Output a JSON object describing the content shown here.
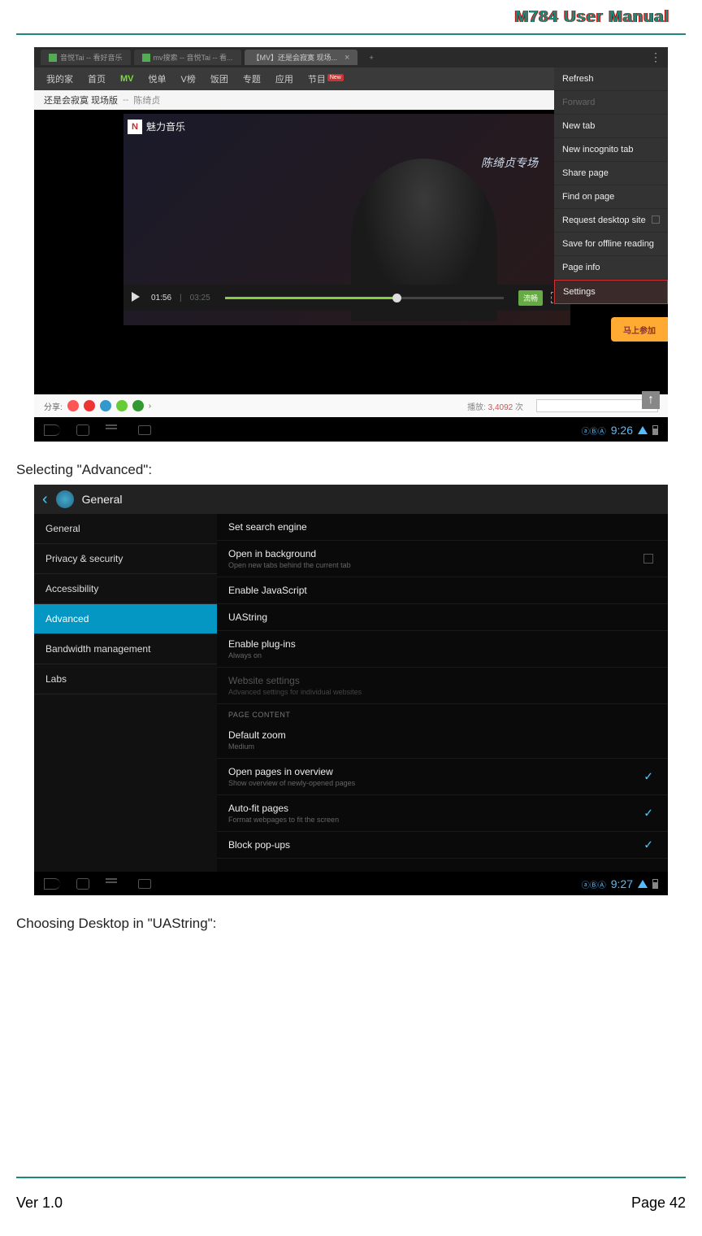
{
  "header": {
    "title": "M784  User  Manual"
  },
  "screenshot1": {
    "tabs": [
      {
        "label": "音悦Tai -- 看好音乐"
      },
      {
        "label": "mv搜索 -- 音悦Tai -- 看..."
      },
      {
        "label": "【MV】还是会寂寞 现场..."
      }
    ],
    "tab_add": "+",
    "tab_menu": "⋮",
    "nav": [
      "我的家",
      "首页",
      "MV",
      "悦单",
      "V榜",
      "饭团",
      "专题",
      "应用",
      "节目"
    ],
    "nav_new": "New",
    "song_title": "还是会寂寞 现场版",
    "song_sep": "--",
    "song_artist": "陈绮贞",
    "video_logo": "N",
    "video_logo_text": "魅力音乐",
    "video_overlay": "陈绮贞专场",
    "join_badge": "马上参加",
    "context_menu": {
      "refresh": "Refresh",
      "forward": "Forward",
      "new_tab": "New tab",
      "incognito": "New incognito tab",
      "share": "Share page",
      "find": "Find on page",
      "desktop": "Request desktop site",
      "offline": "Save for offline reading",
      "pageinfo": "Page info",
      "settings": "Settings"
    },
    "player": {
      "time_current": "01:56",
      "time_sep": "|",
      "time_total": "03:25",
      "quality": "流畅"
    },
    "share": {
      "label": "分享:",
      "arrow": "›",
      "views_label": "播放:",
      "views": "3,4092",
      "views_suffix": "次"
    },
    "scroll_up": "↑",
    "status": {
      "apps": "ⓐⒷⒶ",
      "time": "9:26"
    }
  },
  "caption1": "Selecting \"Advanced\":",
  "screenshot2": {
    "header": {
      "back": "‹",
      "title": "General"
    },
    "sidebar": {
      "general": "General",
      "privacy": "Privacy & security",
      "accessibility": "Accessibility",
      "advanced": "Advanced",
      "bandwidth": "Bandwidth management",
      "labs": "Labs"
    },
    "settings": {
      "search": "Set search engine",
      "bg_title": "Open in background",
      "bg_sub": "Open new tabs behind the current tab",
      "js": "Enable JavaScript",
      "ua": "UAString",
      "plugins_title": "Enable plug-ins",
      "plugins_sub": "Always on",
      "website_title": "Website settings",
      "website_sub": "Advanced settings for individual websites",
      "section": "PAGE CONTENT",
      "zoom_title": "Default zoom",
      "zoom_sub": "Medium",
      "overview_title": "Open pages in overview",
      "overview_sub": "Show overview of newly-opened pages",
      "autofit_title": "Auto-fit pages",
      "autofit_sub": "Format webpages to fit the screen",
      "popups": "Block pop-ups"
    },
    "status": {
      "apps": "ⓐⒷⒶ",
      "time": "9:27"
    }
  },
  "caption2": "Choosing Desktop in \"UAString\":",
  "footer": {
    "ver": "Ver 1.0",
    "page": "Page 42"
  }
}
